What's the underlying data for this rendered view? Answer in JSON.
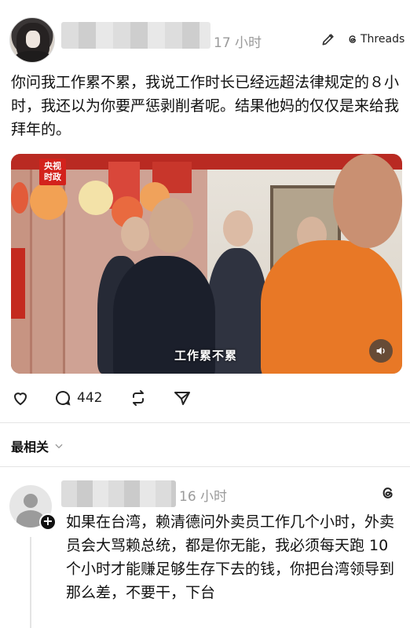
{
  "post": {
    "time": "17 小时",
    "threads_label": "Threads",
    "text": "你问我工作累不累，我说工作时长已经远超法律规定的８小时，我还以为你要严惩剥削者呢。结果他妈的仅仅是来给我拜年的。",
    "media": {
      "logo_text": "央视\n时政",
      "subtitle": "工作累不累"
    },
    "actions": {
      "comment_count": "442"
    }
  },
  "sort": {
    "label": "最相关"
  },
  "reply": {
    "time": "16 小时",
    "text": "如果在台湾，赖清德问外卖员工作几个小时，外卖员会大骂赖总统，都是你无能，我必须每天跑 10 个小时才能赚足够生存下去的钱，你把台湾领导到那么差，不要干，下台"
  },
  "icons": {
    "edit": "pencil-icon",
    "threads": "threads-logo-icon",
    "like": "heart-icon",
    "comment": "comment-bubble-icon",
    "repost": "repost-icon",
    "share": "send-icon",
    "volume": "speaker-icon",
    "chevron": "chevron-down-icon",
    "plus": "plus-icon"
  }
}
